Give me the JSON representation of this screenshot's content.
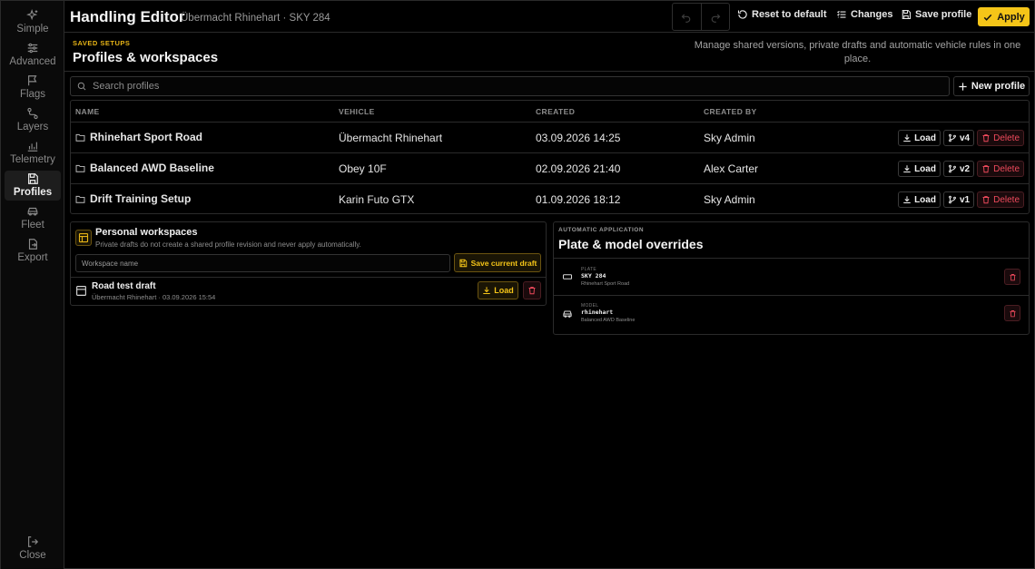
{
  "sidebar": {
    "items": [
      {
        "label": "Simple",
        "icon": "sparkles-icon",
        "active": false
      },
      {
        "label": "Advanced",
        "icon": "sliders-icon",
        "active": false
      },
      {
        "label": "Flags",
        "icon": "flag-icon",
        "active": false
      },
      {
        "label": "Layers",
        "icon": "route-icon",
        "active": false
      },
      {
        "label": "Telemetry",
        "icon": "chart-icon",
        "active": false
      },
      {
        "label": "Profiles",
        "icon": "save-icon",
        "active": true
      },
      {
        "label": "Fleet",
        "icon": "car-icon",
        "active": false
      },
      {
        "label": "Export",
        "icon": "export-icon",
        "active": false
      }
    ],
    "close_label": "Close"
  },
  "header": {
    "title": "Handling Editor",
    "subtitle": "Übermacht Rhinehart · SKY 284",
    "reset_label": "Reset to default",
    "changes_label": "Changes",
    "save_label": "Save profile",
    "apply_label": "Apply"
  },
  "page": {
    "eyebrow": "SAVED SETUPS",
    "title": "Profiles & workspaces",
    "description": "Manage shared versions, private drafts and automatic vehicle rules in one place."
  },
  "search": {
    "placeholder": "Search profiles",
    "value": ""
  },
  "new_profile_label": "New profile",
  "table": {
    "columns": [
      "NAME",
      "VEHICLE",
      "CREATED",
      "CREATED BY"
    ],
    "rows": [
      {
        "name": "Rhinehart Sport Road",
        "vehicle": "Übermacht Rhinehart",
        "created": "03.09.2026 14:25",
        "created_by": "Sky Admin",
        "version": "v4"
      },
      {
        "name": "Balanced AWD Baseline",
        "vehicle": "Obey 10F",
        "created": "02.09.2026 21:40",
        "created_by": "Alex Carter",
        "version": "v2"
      },
      {
        "name": "Drift Training Setup",
        "vehicle": "Karin Futo GTX",
        "created": "01.09.2026 18:12",
        "created_by": "Sky Admin",
        "version": "v1"
      }
    ],
    "load_label": "Load",
    "delete_label": "Delete"
  },
  "workspaces": {
    "title": "Personal workspaces",
    "description": "Private drafts do not create a shared profile revision and never apply automatically.",
    "input_placeholder": "Workspace name",
    "input_value": "",
    "save_draft_label": "Save current draft",
    "drafts": [
      {
        "title": "Road test draft",
        "meta": "Übermacht Rhinehart · 03.09.2026 15:54",
        "load_label": "Load"
      }
    ]
  },
  "overrides": {
    "eyebrow": "AUTOMATIC APPLICATION",
    "title": "Plate & model overrides",
    "items": [
      {
        "kind": "PLATE",
        "value": "SKY 284",
        "profile": "Rhinehart Sport Road",
        "icon": "plate-icon"
      },
      {
        "kind": "MODEL",
        "value": "rhinehart",
        "profile": "Balanced AWD Baseline",
        "icon": "car-icon"
      }
    ]
  },
  "colors": {
    "accent": "#f5c518",
    "danger": "#ef4a5c",
    "background": "#000000",
    "border": "#2b2b2b"
  }
}
